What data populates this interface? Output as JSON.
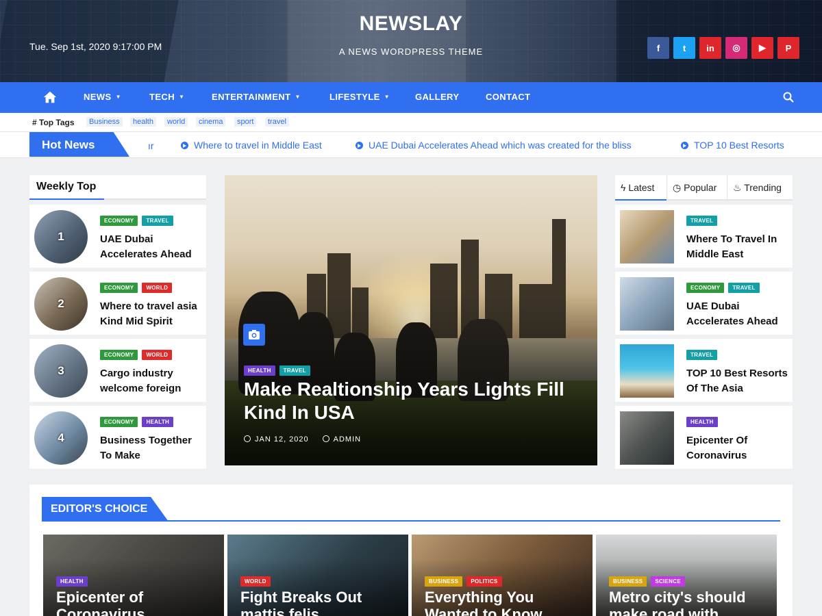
{
  "header": {
    "datetime": "Tue. Sep 1st, 2020 9:17:00 PM",
    "site_title": "NEWSLAY",
    "tagline": "A NEWS WORDPRESS THEME",
    "socials": [
      {
        "icon": "facebook-icon",
        "glyph": "f",
        "color": "#3b5998"
      },
      {
        "icon": "twitter-icon",
        "glyph": "t",
        "color": "#1da1f2"
      },
      {
        "icon": "linkedin-icon",
        "glyph": "in",
        "color": "#e0262d"
      },
      {
        "icon": "instagram-icon",
        "glyph": "◎",
        "color": "#d62976"
      },
      {
        "icon": "youtube-icon",
        "glyph": "▶",
        "color": "#e0262d"
      },
      {
        "icon": "pinterest-icon",
        "glyph": "P",
        "color": "#e0262d"
      }
    ]
  },
  "nav": {
    "home_icon": "home-icon",
    "items": [
      {
        "label": "NEWS",
        "dropdown": true
      },
      {
        "label": "TECH",
        "dropdown": true
      },
      {
        "label": "ENTERTAINMENT",
        "dropdown": true
      },
      {
        "label": "LIFESTYLE",
        "dropdown": true
      },
      {
        "label": "GALLERY",
        "dropdown": false
      },
      {
        "label": "CONTACT",
        "dropdown": false
      }
    ],
    "search_icon": "search-icon",
    "color": "#2f6ff0"
  },
  "top_tags": {
    "label": "# Top Tags",
    "tags": [
      "Business",
      "health",
      "world",
      "cinema",
      "sport",
      "travel"
    ]
  },
  "hot_news": {
    "label": "Hot News",
    "fragment": "ır",
    "items": [
      "Where to travel in Middle East",
      "UAE Dubai Accelerates Ahead which was created for the bliss",
      "TOP 10 Best Resorts"
    ]
  },
  "weekly_top": {
    "title": "Weekly Top",
    "items": [
      {
        "num": "1",
        "badges": [
          {
            "label": "ECONOMY",
            "cls": "c-econ"
          },
          {
            "label": "TRAVEL",
            "cls": "c-travel"
          }
        ],
        "title": "UAE Dubai Accelerates Ahead"
      },
      {
        "num": "2",
        "badges": [
          {
            "label": "ECONOMY",
            "cls": "c-econ"
          },
          {
            "label": "WORLD",
            "cls": "c-world"
          }
        ],
        "title": "Where to travel asia Kind Mid Spirit"
      },
      {
        "num": "3",
        "badges": [
          {
            "label": "ECONOMY",
            "cls": "c-econ"
          },
          {
            "label": "WORLD",
            "cls": "c-world"
          }
        ],
        "title": "Cargo industry welcome foreign"
      },
      {
        "num": "4",
        "badges": [
          {
            "label": "ECONOMY",
            "cls": "c-econ"
          },
          {
            "label": "HEALTH",
            "cls": "c-health"
          }
        ],
        "title": "Business Together To Make"
      }
    ]
  },
  "hero": {
    "badges": [
      {
        "label": "HEALTH",
        "cls": "c-health"
      },
      {
        "label": "TRAVEL",
        "cls": "c-travel"
      }
    ],
    "title": "Make Realtionship Years Lights Fill Kind In USA",
    "date": "JAN 12, 2020",
    "author": "ADMIN"
  },
  "side_tabs": {
    "tabs": [
      {
        "label": "Latest",
        "icon": "bolt-icon"
      },
      {
        "label": "Popular",
        "icon": "clock-icon"
      },
      {
        "label": "Trending",
        "icon": "fire-icon"
      }
    ],
    "items": [
      {
        "badges": [
          {
            "label": "TRAVEL",
            "cls": "c-travel"
          }
        ],
        "title": "Where To Travel In Middle East"
      },
      {
        "badges": [
          {
            "label": "ECONOMY",
            "cls": "c-econ"
          },
          {
            "label": "TRAVEL",
            "cls": "c-travel"
          }
        ],
        "title": "UAE Dubai Accelerates Ahead"
      },
      {
        "badges": [
          {
            "label": "TRAVEL",
            "cls": "c-travel"
          }
        ],
        "title": "TOP 10 Best Resorts Of The Asia"
      },
      {
        "badges": [
          {
            "label": "HEALTH",
            "cls": "c-health"
          }
        ],
        "title": "Epicenter Of Coronavirus"
      }
    ]
  },
  "editors_choice": {
    "title": "EDITOR'S CHOICE",
    "items": [
      {
        "badges": [
          {
            "label": "HEALTH",
            "cls": "c-health"
          }
        ],
        "title": "Epicenter of Coronavirus"
      },
      {
        "badges": [
          {
            "label": "WORLD",
            "cls": "c-world"
          }
        ],
        "title": "Fight Breaks Out mattis felis"
      },
      {
        "badges": [
          {
            "label": "BUSINESS",
            "cls": "c-business"
          },
          {
            "label": "POLITICS",
            "cls": "c-politics"
          }
        ],
        "title": "Everything You Wanted to Know"
      },
      {
        "badges": [
          {
            "label": "BUSINESS",
            "cls": "c-business"
          },
          {
            "label": "SCIENCE",
            "cls": "c-science"
          }
        ],
        "title": "Metro city's should make road with"
      }
    ]
  }
}
